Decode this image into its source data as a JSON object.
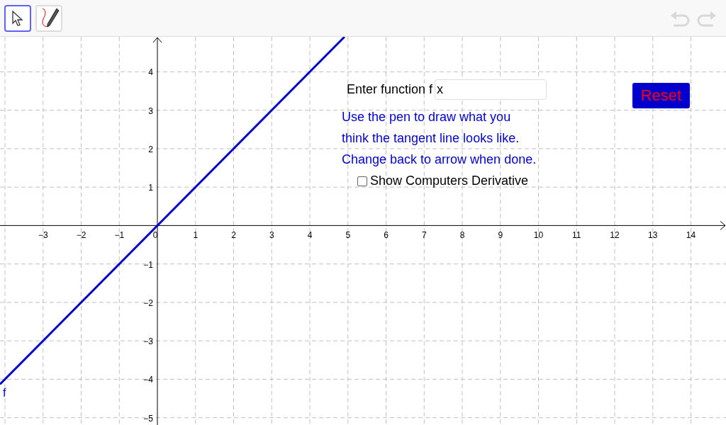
{
  "toolbar": {
    "tools": [
      {
        "kind": "move",
        "selected": true
      },
      {
        "kind": "pen",
        "selected": false
      }
    ],
    "undo": {
      "disabled": true
    },
    "redo": {
      "disabled": true
    }
  },
  "controls": {
    "input": {
      "label": "Enter function f",
      "value": "x"
    },
    "instructions": [
      "Use the pen to draw what you",
      "think the tangent line looks like.",
      "Change back to arrow when done."
    ],
    "checkbox": {
      "label": "Show Computers Derivative",
      "checked": false
    },
    "reset_button": {
      "label": "Reset"
    }
  },
  "graph": {
    "chart_data": {
      "type": "line",
      "grid": true,
      "xlim": [
        -4.13,
        14.92
      ],
      "ylim": [
        -5.19,
        4.91
      ],
      "x": [
        -4.13,
        4.91
      ],
      "series": [
        {
          "name": "f",
          "color": "#0000cc",
          "values": [
            -4.13,
            4.91
          ]
        }
      ],
      "xticks": [
        {
          "value": -3,
          "label": "−3"
        },
        {
          "value": -2,
          "label": "−2"
        },
        {
          "value": -1,
          "label": "−1"
        },
        0,
        1,
        2,
        3,
        4,
        5,
        6,
        7,
        8,
        9,
        10,
        11,
        12,
        13,
        14
      ],
      "yticks": [
        {
          "value": -5,
          "label": "−5"
        },
        {
          "value": -4,
          "label": "−4"
        },
        {
          "value": -3,
          "label": "−3"
        },
        {
          "value": -2,
          "label": "−2"
        },
        {
          "value": -1,
          "label": "−1"
        },
        1,
        2,
        3,
        4
      ]
    }
  }
}
